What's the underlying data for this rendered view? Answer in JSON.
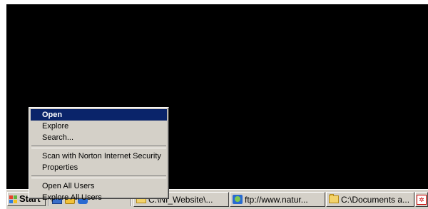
{
  "context_menu": {
    "items": [
      {
        "label": "Open"
      },
      {
        "label": "Explore"
      },
      {
        "label": "Search..."
      },
      {
        "label": "Scan with Norton Internet Security"
      },
      {
        "label": "Properties"
      },
      {
        "label": "Open All Users"
      },
      {
        "label": "Explore All Users"
      }
    ],
    "selected_color": "#0a246a"
  },
  "taskbar": {
    "start_label": "Start",
    "quick_launch": [
      "show-desktop-icon",
      "outlook-icon",
      "internet-explorer-icon"
    ],
    "tasks": [
      {
        "label": "C:\\NI_Website\\...",
        "icon": "folder-icon"
      },
      {
        "label": "ftp://www.natur...",
        "icon": "internet-explorer-icon"
      },
      {
        "label": "C:\\Documents a...",
        "icon": "folder-icon"
      },
      {
        "label": "",
        "icon": "pdf-icon"
      }
    ]
  },
  "colors": {
    "desktop": "#000000",
    "taskbar": "#d4d0c8"
  }
}
